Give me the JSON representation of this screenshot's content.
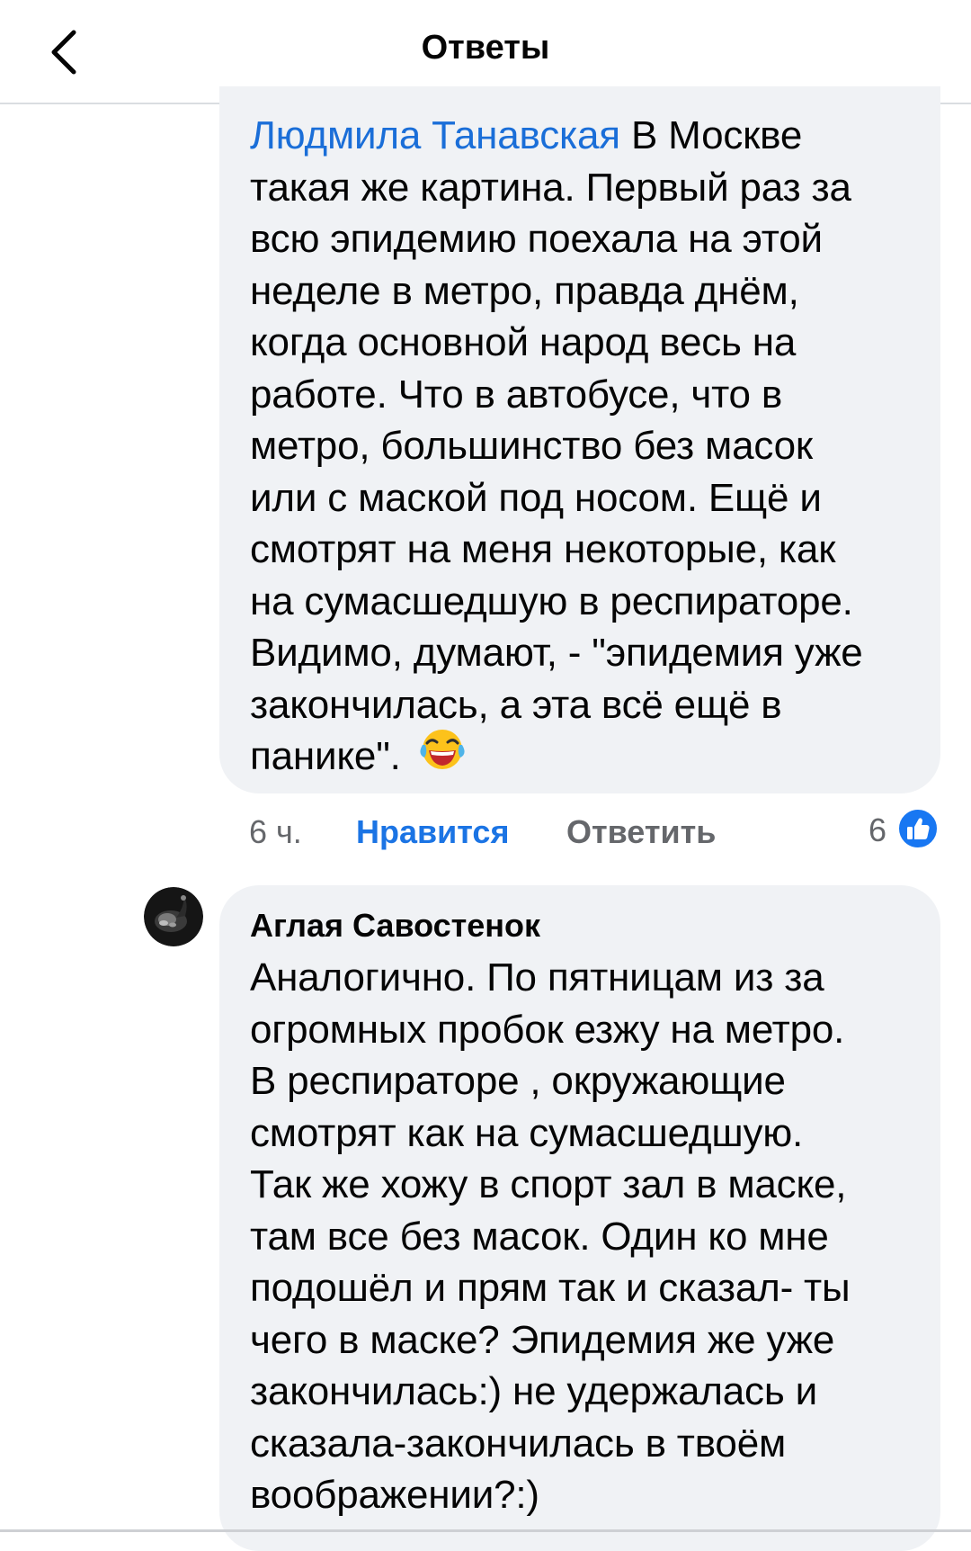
{
  "header": {
    "title": "Ответы",
    "back_icon": "chevron-left-icon"
  },
  "comment1": {
    "author_link": "Людмила Танавская",
    "text": " В Москве\nтакая же картина. Первый раз за\nвсю эпидемию поехала на этой\nнеделе в метро, правда днём,\nкогда основной народ весь на\nработе. Что в автобусе, что в\nметро, большинство без масок\nили с маской под носом. Ещё и\nсмотрят на меня некоторые, как\nна сумасшедшую в респираторе.\nВидимо, думают, - \"эпидемия уже\nзакончилась, а эта всё ещё в\nпанике\". ",
    "emoji": "face-with-tears-of-joy-icon"
  },
  "actions": {
    "time": "6 ч.",
    "like": "Нравится",
    "reply": "Ответить",
    "reaction_count": "6",
    "reaction_icon": "like-reaction-icon"
  },
  "comment2": {
    "avatar": "avatar",
    "author": "Аглая Савостенок",
    "text": "Аналогично. По пятницам из за\nогромных пробок езжу на метро.\nВ респираторе , окружающие\nсмотрят как на сумасшедшую.\nТак же хожу в спорт зал в маске,\nтам все без масок. Один ко мне\nподошёл и прям так и сказал- ты\nчего в маске? Эпидемия же уже\nзакончилась:) не удержалась и\nсказала-закончилась в твоём\nвоображении?:)"
  },
  "colors": {
    "link": "#1a6ed8",
    "like_active": "#1b74e4",
    "bubble_bg": "#f0f2f5",
    "secondary_text": "#65676b"
  }
}
